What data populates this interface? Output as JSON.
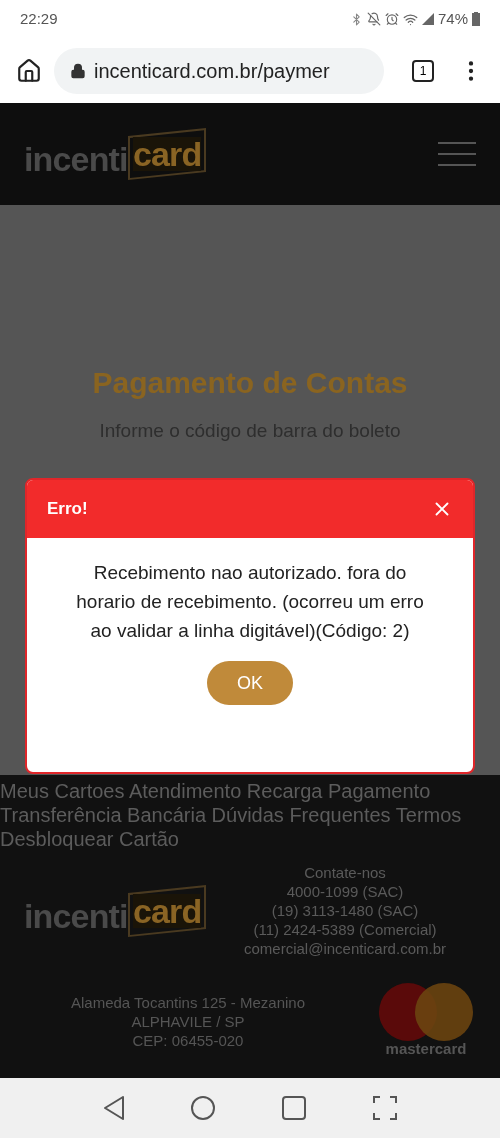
{
  "status_bar": {
    "time": "22:29",
    "battery": "74%"
  },
  "browser": {
    "url": "incenticard.com.br/paymer",
    "tab_count": "1"
  },
  "header": {
    "logo": [
      "incenti",
      "card"
    ]
  },
  "page": {
    "title": "Pagamento de Contas",
    "subtitle": "Informe o código de barra do boleto"
  },
  "dialog": {
    "title": "Erro!",
    "message": "Recebimento nao autorizado. fora do horario de recebimento. (ocorreu um erro ao validar a linha digitável)(Código: 2)",
    "button": "OK"
  },
  "footer": {
    "links": [
      "Meus Cartoes",
      "Atendimento",
      "Recarga",
      "Pagamento",
      "Transferência Bancária",
      "Dúvidas Frequentes",
      "Termos",
      "Desbloquear Cartão"
    ],
    "logo": [
      "incenti",
      "card"
    ],
    "contact": [
      "Contate-nos",
      "4000-1099 (SAC)",
      "(19) 3113-1480 (SAC)",
      "(11) 2424-5389 (Comercial)",
      "comercial@incenticard.com.br"
    ],
    "address": [
      "Alameda Tocantins 125 - Mezanino",
      "ALPHAVILE / SP",
      "CEP: 06455-020"
    ],
    "card_brand": "mastercard"
  }
}
